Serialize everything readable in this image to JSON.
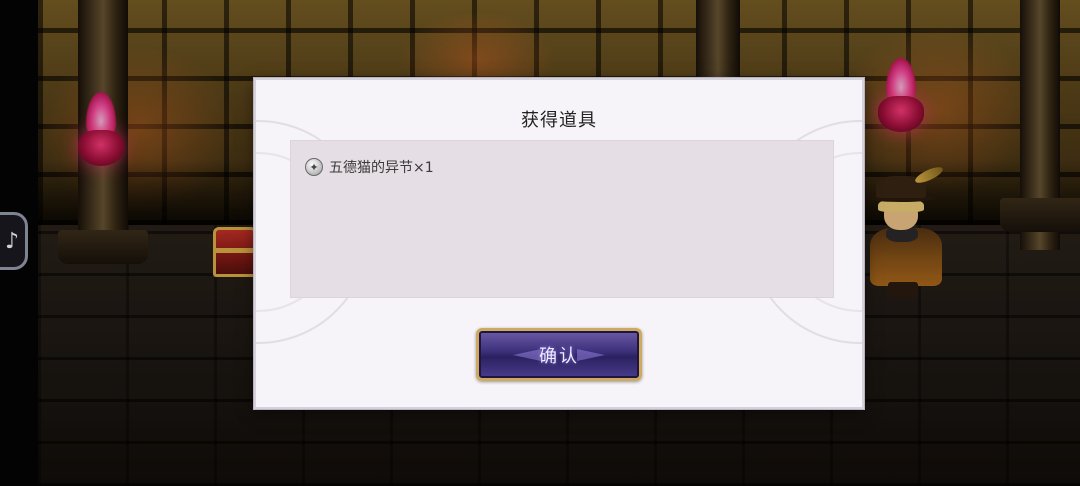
{
  "dialog": {
    "title": "获得道具",
    "items": [
      {
        "name": "五德猫的异节×1",
        "icon": "item-token-icon"
      }
    ],
    "confirm_label": "确认"
  },
  "side_button": {
    "icon": "tiktok-icon"
  },
  "colors": {
    "dialog_bg": "#f6f4f8",
    "panel_bg": "#e5dee4",
    "button_gold_border": "#cfa960",
    "button_purple": "#3b2f78",
    "torch_pink": "#ff4fa4"
  }
}
